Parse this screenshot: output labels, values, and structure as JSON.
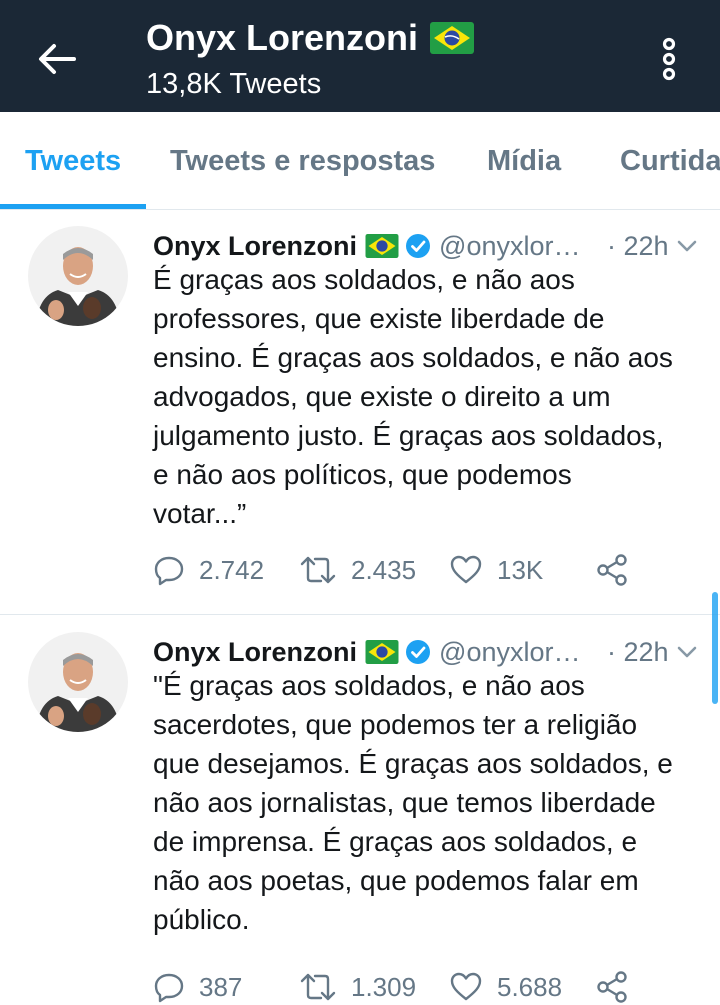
{
  "header": {
    "title": "Onyx Lorenzoni",
    "subtitle": "13,8K Tweets",
    "back_icon": "arrow-left-icon",
    "menu_icon": "kebab-menu-icon"
  },
  "tabs": [
    {
      "label": "Tweets",
      "active": true
    },
    {
      "label": "Tweets e respostas",
      "active": false
    },
    {
      "label": "Mídia",
      "active": false
    },
    {
      "label": "Curtidas",
      "active": false
    }
  ],
  "colors": {
    "header_bg": "#1b2836",
    "accent": "#1da1f2",
    "secondary_text": "#657786"
  },
  "tweets": [
    {
      "name": "Onyx Lorenzoni",
      "handle": "@onyxlorenzoni",
      "time": "· 22h",
      "text": "É graças aos soldados, e não aos\nprofessores, que existe liberdade de\nensino. É graças aos soldados, e não aos\nadvogados, que existe o direito a um\njulgamento justo. É graças aos soldados,\ne não aos políticos, que podemos\nvotar...”",
      "replies": "2.742",
      "retweets": "2.435",
      "likes": "13K"
    },
    {
      "name": "Onyx Lorenzoni",
      "handle": "@onyxlorenzoni",
      "time": "· 22h",
      "text": "\"É graças aos soldados, e não aos\nsacerdotes, que podemos ter a religião\nque desejamos. É graças aos soldados, e\nnão aos jornalistas, que temos liberdade\nde imprensa. É graças aos soldados, e\nnão aos poetas, que podemos falar em\npúblico.",
      "replies": "387",
      "retweets": "1.309",
      "likes": "5.688"
    }
  ]
}
